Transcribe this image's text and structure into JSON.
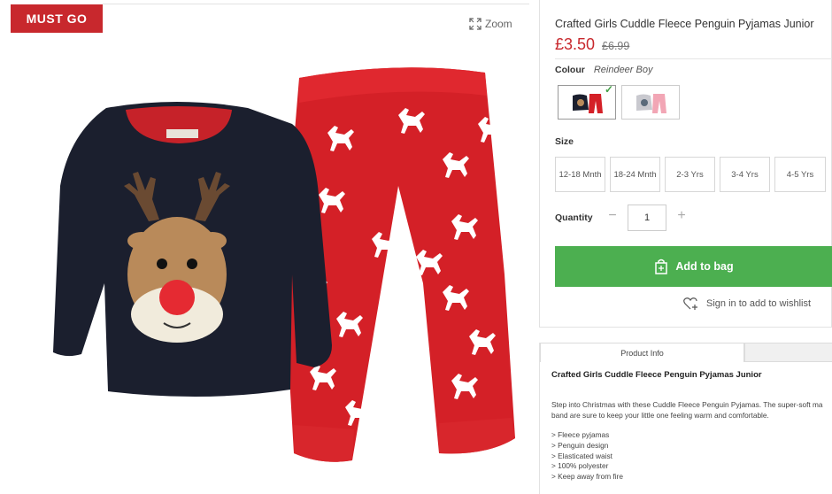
{
  "badge": "MUST GO",
  "zoom_label": "Zoom",
  "product": {
    "title": "Crafted Girls Cuddle Fleece Penguin Pyjamas Junior",
    "price_now": "£3.50",
    "price_was": "£6.99",
    "colour_label": "Colour",
    "colour_value": "Reindeer Boy",
    "swatches": [
      {
        "name": "Reindeer Boy",
        "selected": true
      },
      {
        "name": "Grey/Pink",
        "selected": false
      }
    ],
    "size_label": "Size",
    "sizes": [
      "12-18 Mnth",
      "18-24 Mnth",
      "2-3 Yrs",
      "3-4 Yrs",
      "4-5 Yrs"
    ],
    "quantity_label": "Quantity",
    "quantity_value": "1",
    "add_to_bag": "Add to bag",
    "wishlist": "Sign in to add to wishlist"
  },
  "info": {
    "tab_active": "Product Info",
    "title": "Crafted Girls Cuddle Fleece Penguin Pyjamas Junior",
    "desc_line1": "Step into Christmas with these Cuddle Fleece Penguin Pyjamas. The super-soft ma",
    "desc_line2": "band are sure to keep your little one feeling warm and comfortable.",
    "bullets": [
      "> Fleece pyjamas",
      "> Penguin design",
      "> Elasticated waist",
      "> 100% polyester",
      "> Keep away from fire"
    ]
  },
  "colors": {
    "accent_red": "#c8282d",
    "add_green": "#4caf50"
  }
}
